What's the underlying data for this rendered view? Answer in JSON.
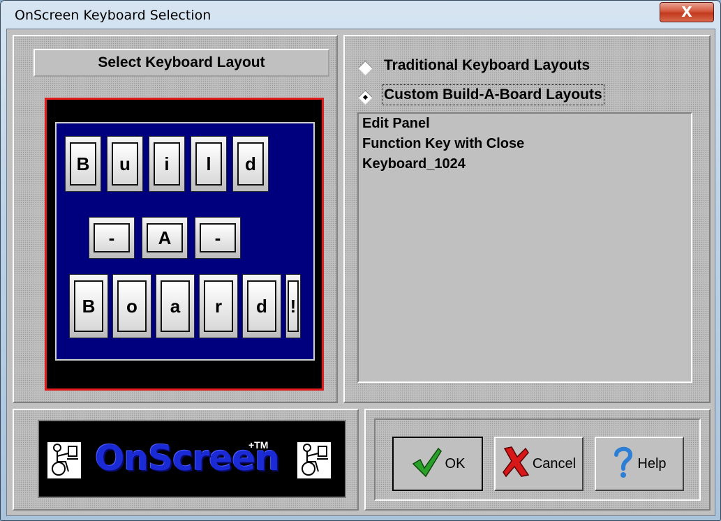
{
  "window": {
    "title": "OnScreen Keyboard Selection",
    "close_label": "X"
  },
  "left_panel": {
    "heading": "Select Keyboard Layout",
    "preview": {
      "row1": [
        "B",
        "u",
        "i",
        "l",
        "d"
      ],
      "row2": [
        "-",
        "A",
        "-"
      ],
      "row3": [
        "B",
        "o",
        "a",
        "r",
        "d",
        "!"
      ]
    }
  },
  "right_panel": {
    "options": [
      {
        "label": "Traditional Keyboard Layouts",
        "selected": false
      },
      {
        "label": "Custom Build-A-Board Layouts",
        "selected": true
      }
    ],
    "layouts": [
      "Edit Panel",
      "Function Key with Close",
      "Keyboard_1024"
    ]
  },
  "logo": {
    "text": "OnScreen",
    "trademark": "+TM"
  },
  "buttons": {
    "ok": "OK",
    "cancel": "Cancel",
    "help": "Help"
  },
  "colors": {
    "preview_border": "#e21b1b",
    "board_background": "#00007e",
    "ok_check": "#2aa02a",
    "cancel_x": "#d81818",
    "help_question": "#2d7fd6"
  }
}
